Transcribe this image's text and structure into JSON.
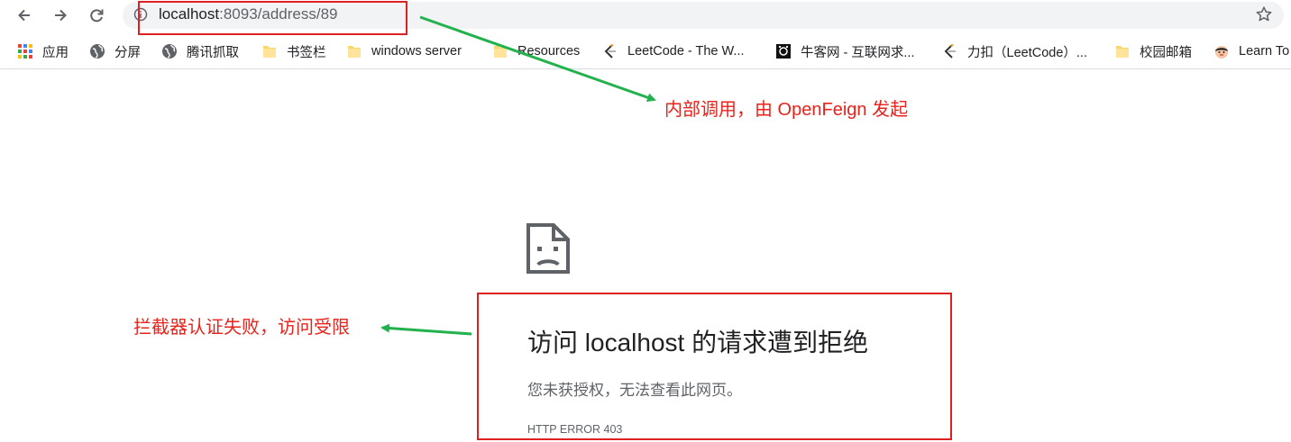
{
  "browser": {
    "url_host": "localhost",
    "url_path": ":8093/address/89",
    "icons": {
      "back": "arrow-left-icon",
      "forward": "arrow-right-icon",
      "reload": "reload-icon",
      "info": "info-icon",
      "bookmark_star": "star-icon"
    }
  },
  "bookmarks": [
    {
      "label": "应用",
      "icon": "apps-grid-icon"
    },
    {
      "label": "分屏",
      "icon": "globe-icon"
    },
    {
      "label": "腾讯抓取",
      "icon": "globe-icon"
    },
    {
      "label": "书签栏",
      "icon": "folder-icon"
    },
    {
      "label": "windows server",
      "icon": "folder-icon"
    },
    {
      "label": "Resources",
      "icon": "folder-icon"
    },
    {
      "label": "LeetCode - The W...",
      "icon": "leetcode-icon"
    },
    {
      "label": "牛客网 - 互联网求...",
      "icon": "nowcoder-icon"
    },
    {
      "label": "力扣（LeetCode）...",
      "icon": "leetcode-icon"
    },
    {
      "label": "校园邮箱",
      "icon": "folder-icon"
    },
    {
      "label": "Learn To",
      "icon": "avatar-icon"
    }
  ],
  "error_page": {
    "icon": "sad-page-icon",
    "title": "访问 localhost 的请求遭到拒绝",
    "message": "您未获授权，无法查看此网页。",
    "code": "HTTP ERROR 403"
  },
  "annotations": {
    "note_top": "内部调用，由 OpenFeign 发起",
    "note_left": "拦截器认证失败，访问受限",
    "box_color": "#e02020",
    "text_color": "#e8231c",
    "arrow_color": "#22b14c"
  }
}
